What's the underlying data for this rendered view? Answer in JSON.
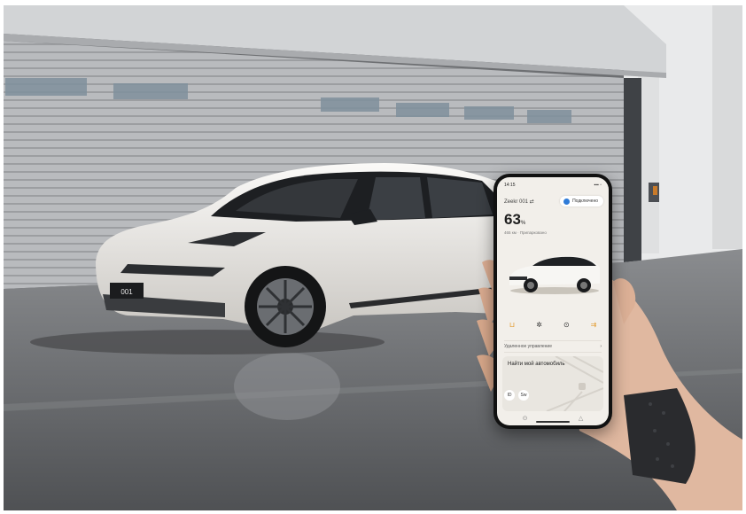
{
  "plate": {
    "text": "001"
  },
  "phone": {
    "status": {
      "time": "14:15",
      "signal": "▪▪▪ ▫"
    },
    "car_name": "Zeekr 001 ⇄",
    "connect_label": "Подключено",
    "battery_value": "63",
    "battery_unit": "%",
    "range_text": "465 км · Припарковано",
    "controls": [
      {
        "icon": "trunk-icon",
        "glyph": "⊔"
      },
      {
        "icon": "fan-icon",
        "glyph": "✲"
      },
      {
        "icon": "lock-icon",
        "glyph": "⊙"
      },
      {
        "icon": "charge-icon",
        "glyph": "⇉"
      }
    ],
    "remote_label": "Удаленное управление",
    "remote_chevron": "›",
    "find_label": "Найти мой автомобиль",
    "pills": [
      "ID",
      "Sw"
    ],
    "tabs": [
      {
        "icon": "car-tab-icon",
        "glyph": "⊙"
      },
      {
        "icon": "person-tab-icon",
        "glyph": "△"
      }
    ]
  },
  "colors": {
    "car_body": "#ece9e4",
    "accent_orange": "#e39b2e",
    "phone_accent_blue": "#2f7bd8"
  }
}
